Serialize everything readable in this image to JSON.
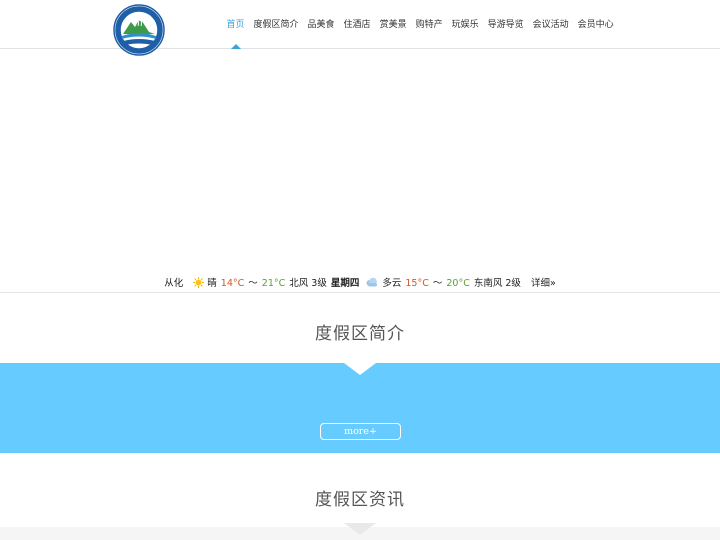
{
  "nav": {
    "items": [
      {
        "label": "首页",
        "active": true
      },
      {
        "label": "度假区简介"
      },
      {
        "label": "品美食"
      },
      {
        "label": "住酒店"
      },
      {
        "label": "赏美景"
      },
      {
        "label": "购特产"
      },
      {
        "label": "玩娱乐"
      },
      {
        "label": "导游导览"
      },
      {
        "label": "会议活动"
      },
      {
        "label": "会员中心"
      }
    ],
    "active_color": "#3aa3dc"
  },
  "weather": {
    "city": "从化",
    "today": {
      "icon": "sun-icon",
      "condition": "晴",
      "low": "14°C",
      "sep": "～",
      "high": "21°C",
      "wind": "北风 3级"
    },
    "next": {
      "day": "星期四",
      "icon": "cloud-icon",
      "condition": "多云",
      "low": "15°C",
      "sep": "～",
      "high": "20°C",
      "wind": "东南风 2级"
    },
    "detail_label": "详细»"
  },
  "sections": {
    "intro": {
      "title": "度假区简介",
      "more_label": "more+",
      "band_color": "#66ccff"
    },
    "news": {
      "title": "度假区资讯"
    }
  }
}
